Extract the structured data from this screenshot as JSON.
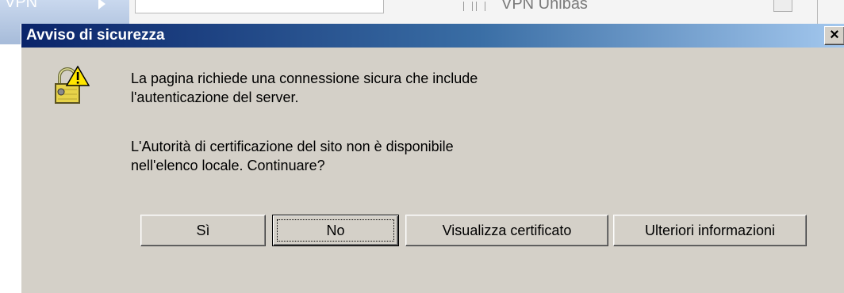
{
  "background": {
    "left_tab": "VPN",
    "vpn_label": "VPN Unibas"
  },
  "dialog": {
    "title": "Avviso di sicurezza",
    "close_label": "×",
    "icon": "security-warning-padlock-icon",
    "message_lines": [
      "La pagina richiede una connessione sicura che include",
      "l'autenticazione del server.",
      "L'Autorità di certificazione del sito non è disponibile",
      "nell'elenco locale. Continuare?"
    ],
    "buttons": {
      "yes": "Sì",
      "no": "No",
      "view_certificate": "Visualizza certificato",
      "more_info": "Ulteriori informazioni"
    },
    "default_button": "no"
  },
  "colors": {
    "dialog_face": "#d4d0c8",
    "titlebar_start": "#0a246a",
    "titlebar_end": "#a6caf0"
  }
}
